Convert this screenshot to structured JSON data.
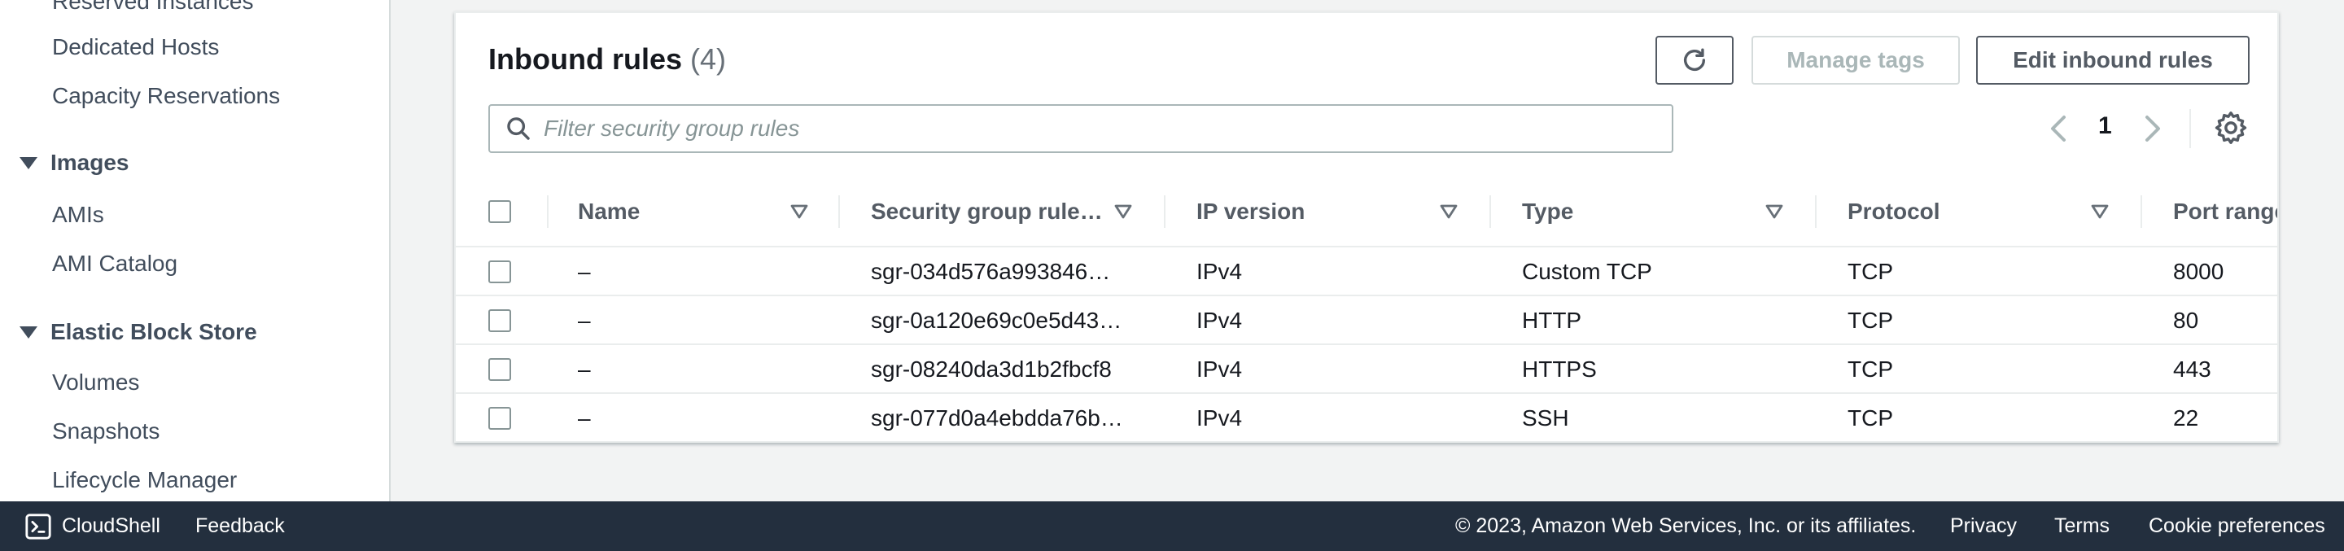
{
  "sidebar": {
    "items": [
      {
        "type": "link",
        "label": "Reserved Instances"
      },
      {
        "type": "link",
        "label": "Dedicated Hosts"
      },
      {
        "type": "link",
        "label": "Capacity Reservations"
      },
      {
        "type": "section",
        "label": "Images"
      },
      {
        "type": "link",
        "label": "AMIs"
      },
      {
        "type": "link",
        "label": "AMI Catalog"
      },
      {
        "type": "section",
        "label": "Elastic Block Store"
      },
      {
        "type": "link",
        "label": "Volumes"
      },
      {
        "type": "link",
        "label": "Snapshots"
      },
      {
        "type": "link",
        "label": "Lifecycle Manager"
      }
    ]
  },
  "panel": {
    "title": "Inbound rules",
    "count": "(4)",
    "buttons": {
      "manage_tags": "Manage tags",
      "edit_inbound": "Edit inbound rules"
    },
    "search": {
      "placeholder": "Filter security group rules"
    },
    "pagination": {
      "current_page": "1"
    }
  },
  "table": {
    "columns": [
      "Name",
      "Security group rule…",
      "IP version",
      "Type",
      "Protocol",
      "Port range"
    ],
    "rows": [
      {
        "name": "–",
        "rule_id": "sgr-034d576a993846…",
        "ip_version": "IPv4",
        "type": "Custom TCP",
        "protocol": "TCP",
        "port_range": "8000"
      },
      {
        "name": "–",
        "rule_id": "sgr-0a120e69c0e5d43…",
        "ip_version": "IPv4",
        "type": "HTTP",
        "protocol": "TCP",
        "port_range": "80"
      },
      {
        "name": "–",
        "rule_id": "sgr-08240da3d1b2fbcf8",
        "ip_version": "IPv4",
        "type": "HTTPS",
        "protocol": "TCP",
        "port_range": "443"
      },
      {
        "name": "–",
        "rule_id": "sgr-077d0a4ebdda76b…",
        "ip_version": "IPv4",
        "type": "SSH",
        "protocol": "TCP",
        "port_range": "22"
      }
    ]
  },
  "footer": {
    "cloudshell": "CloudShell",
    "feedback": "Feedback",
    "copyright": "© 2023, Amazon Web Services, Inc. or its affiliates.",
    "privacy": "Privacy",
    "terms": "Terms",
    "cookies": "Cookie preferences"
  },
  "icons": {
    "refresh": "refresh-icon",
    "search": "search-icon",
    "prev": "chevron-left-icon",
    "next": "chevron-right-icon",
    "settings": "gear-icon",
    "sort": "sort-caret-icon",
    "cloudshell": "terminal-icon"
  },
  "colors": {
    "footer_bg": "#232f3e",
    "border": "#eaeded",
    "text": "#16191f",
    "muted": "#545b64"
  }
}
